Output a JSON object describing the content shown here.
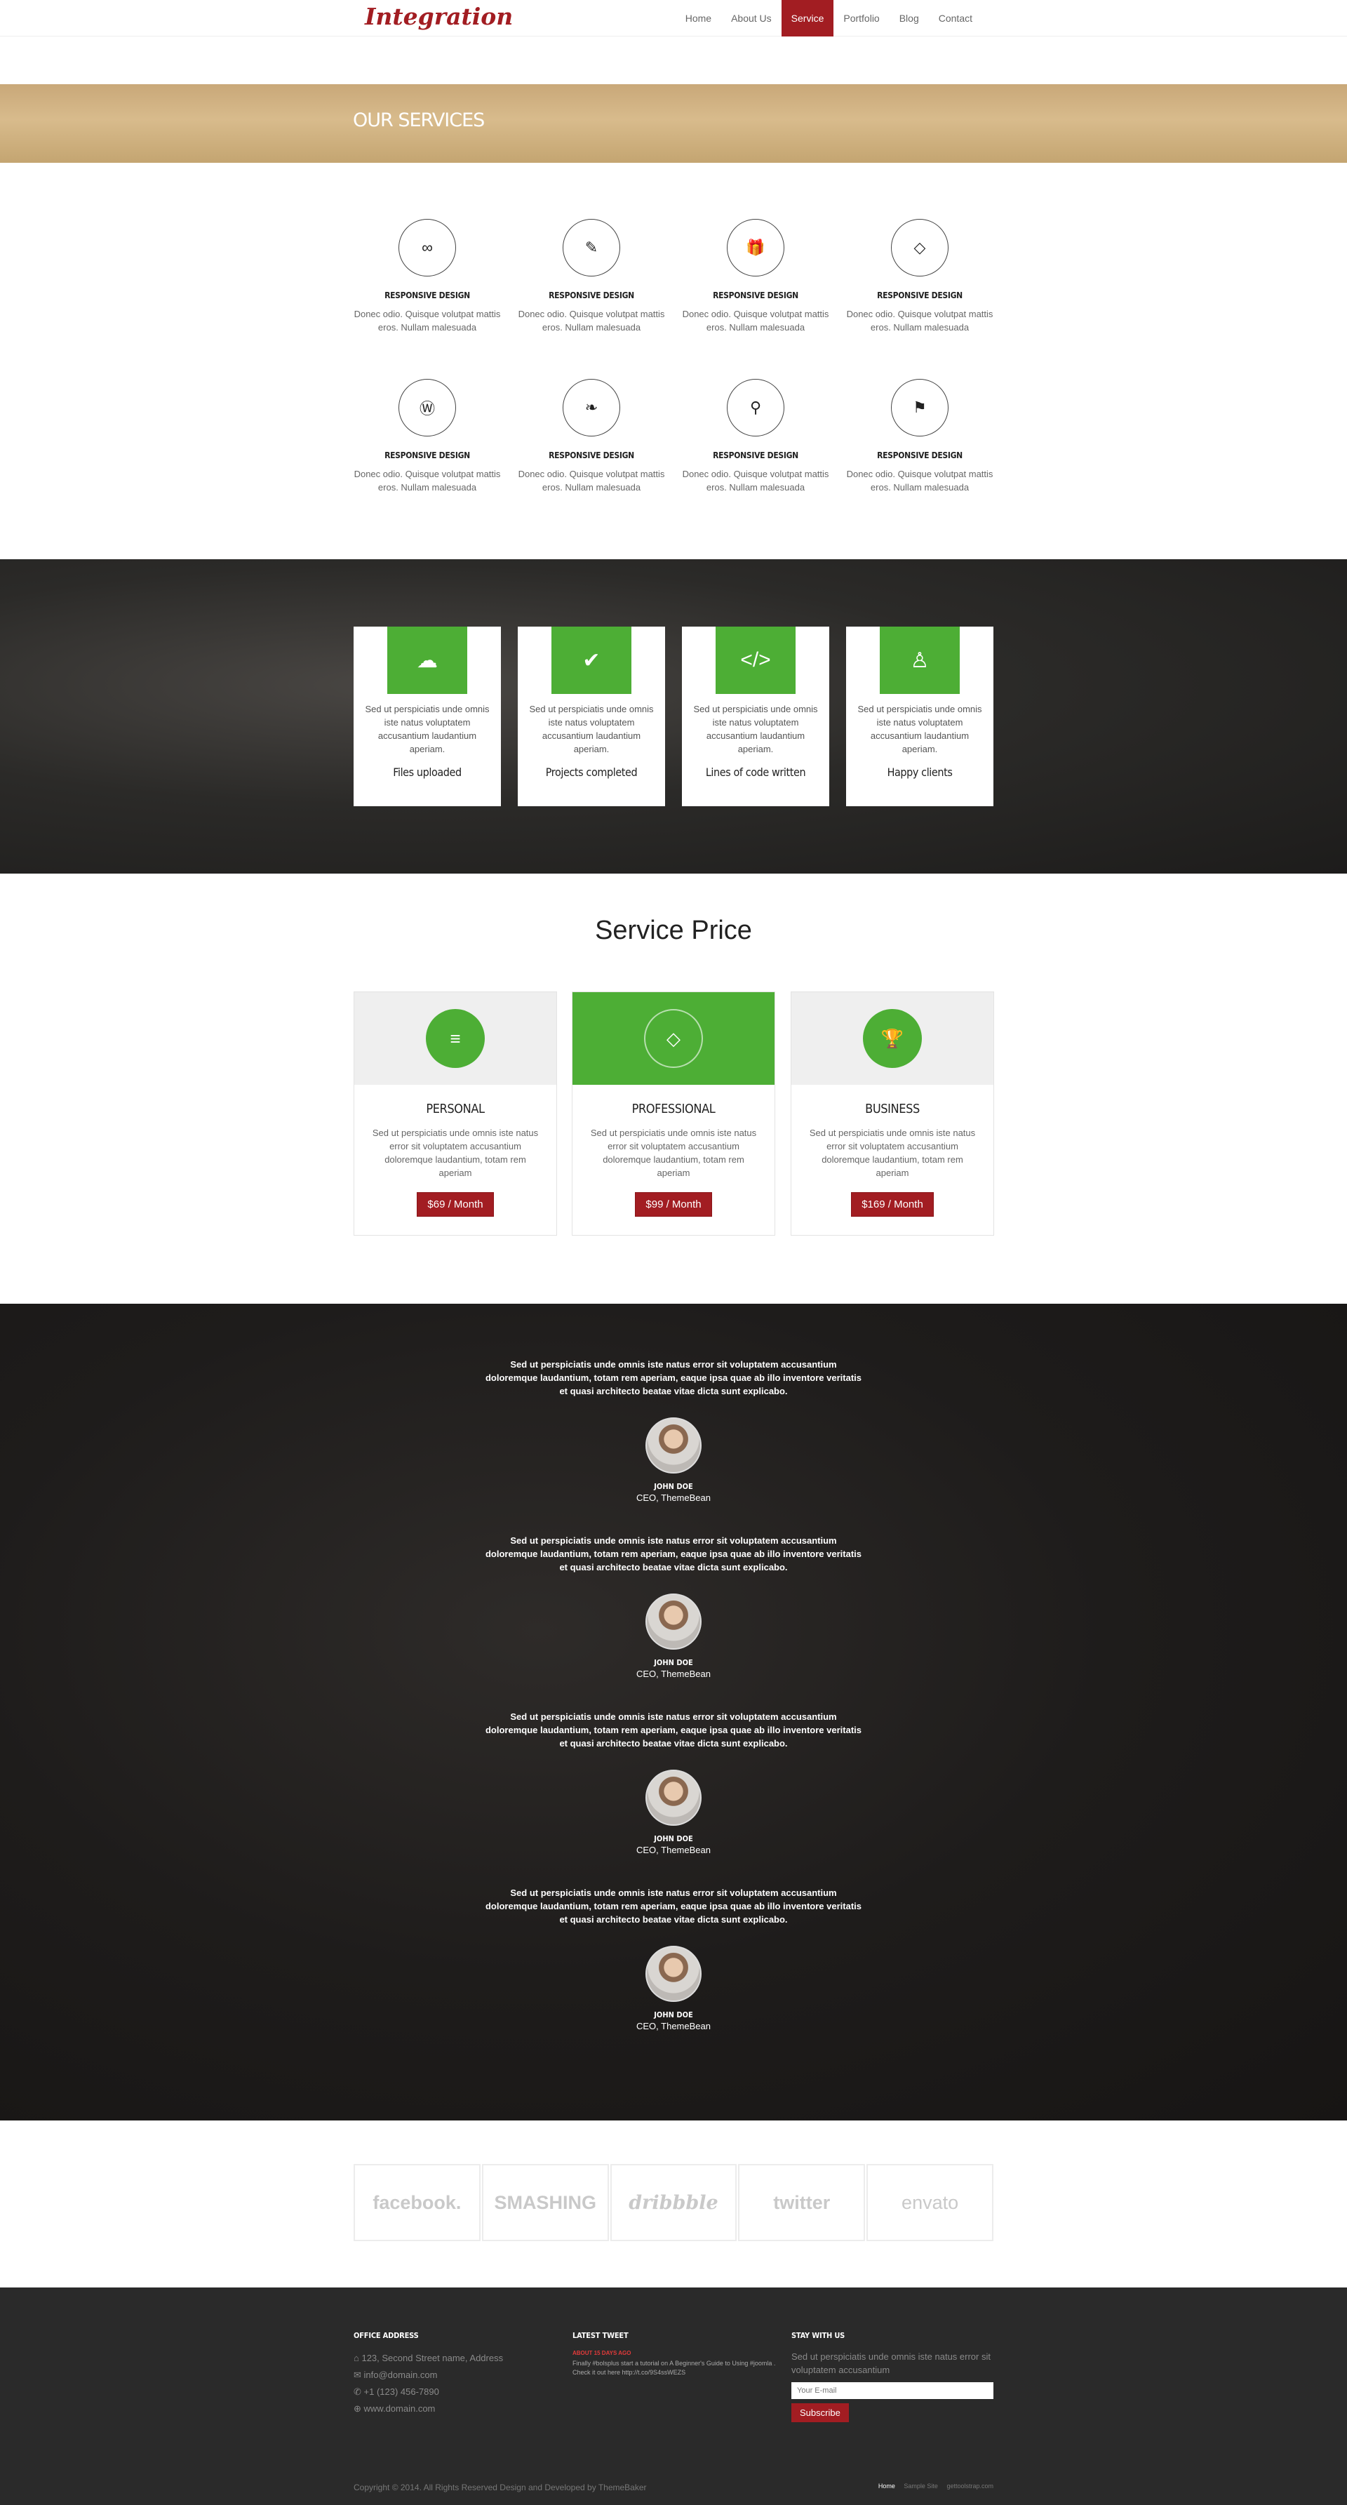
{
  "header": {
    "logo": "Integration",
    "nav": [
      "Home",
      "About Us",
      "Service",
      "Portfolio",
      "Blog",
      "Contact"
    ],
    "active": "Service"
  },
  "banner": {
    "title": "OUR SERVICES"
  },
  "services": {
    "items": [
      {
        "icon": "infinity-icon",
        "glyph": "∞",
        "title": "RESPONSIVE DESIGN",
        "text": "Donec odio. Quisque volutpat mattis eros. Nullam malesuada"
      },
      {
        "icon": "magic-wand-icon",
        "glyph": "✎",
        "title": "RESPONSIVE DESIGN",
        "text": "Donec odio. Quisque volutpat mattis eros. Nullam malesuada"
      },
      {
        "icon": "gift-icon",
        "glyph": "🎁",
        "title": "RESPONSIVE DESIGN",
        "text": "Donec odio. Quisque volutpat mattis eros. Nullam malesuada"
      },
      {
        "icon": "diamond-icon",
        "glyph": "◇",
        "title": "RESPONSIVE DESIGN",
        "text": "Donec odio. Quisque volutpat mattis eros. Nullam malesuada"
      },
      {
        "icon": "wordpress-icon",
        "glyph": "Ⓦ",
        "title": "RESPONSIVE DESIGN",
        "text": "Donec odio. Quisque volutpat mattis eros. Nullam malesuada"
      },
      {
        "icon": "feather-icon",
        "glyph": "❧",
        "title": "RESPONSIVE DESIGN",
        "text": "Donec odio. Quisque volutpat mattis eros. Nullam malesuada"
      },
      {
        "icon": "bicycle-icon",
        "glyph": "⚲",
        "title": "RESPONSIVE DESIGN",
        "text": "Donec odio. Quisque volutpat mattis eros. Nullam malesuada"
      },
      {
        "icon": "flag-icon",
        "glyph": "⚑",
        "title": "RESPONSIVE DESIGN",
        "text": "Donec odio. Quisque volutpat mattis eros. Nullam malesuada"
      }
    ]
  },
  "counters": {
    "items": [
      {
        "icon": "cloud-upload-icon",
        "glyph": "☁",
        "text": "Sed ut perspiciatis unde omnis iste natus voluptatem accusantium laudantium aperiam.",
        "label": "Files uploaded"
      },
      {
        "icon": "check-icon",
        "glyph": "✔",
        "text": "Sed ut perspiciatis unde omnis iste natus voluptatem accusantium laudantium aperiam.",
        "label": "Projects completed"
      },
      {
        "icon": "code-icon",
        "glyph": "</>",
        "text": "Sed ut perspiciatis unde omnis iste natus voluptatem accusantium laudantium aperiam.",
        "label": "Lines of code written"
      },
      {
        "icon": "user-icon",
        "glyph": "♙",
        "text": "Sed ut perspiciatis unde omnis iste natus voluptatem accusantium laudantium aperiam.",
        "label": "Happy clients"
      }
    ]
  },
  "pricing": {
    "title": "Service Price",
    "plans": [
      {
        "icon": "menu-icon",
        "glyph": "≡",
        "name": "PERSONAL",
        "text": "Sed ut perspiciatis unde omnis iste natus error sit voluptatem accusantium doloremque laudantium, totam rem aperiam",
        "price": "$69 / Month"
      },
      {
        "icon": "diamond-icon",
        "glyph": "◇",
        "name": "PROFESSIONAL",
        "text": "Sed ut perspiciatis unde omnis iste natus error sit voluptatem accusantium doloremque laudantium, totam rem aperiam",
        "price": "$99 / Month"
      },
      {
        "icon": "trophy-icon",
        "glyph": "🏆",
        "name": "BUSINESS",
        "text": "Sed ut perspiciatis unde omnis iste natus error sit voluptatem accusantium doloremque laudantium, totam rem aperiam",
        "price": "$169 / Month"
      }
    ]
  },
  "testimonials": [
    {
      "quote": "Sed ut perspiciatis unde omnis iste natus error sit voluptatem accusantium doloremque laudantium, totam rem aperiam, eaque ipsa quae ab illo inventore veritatis et quasi architecto beatae vitae dicta sunt explicabo.",
      "name": "JOHN DOE",
      "role": "CEO, ThemeBean"
    },
    {
      "quote": "Sed ut perspiciatis unde omnis iste natus error sit voluptatem accusantium doloremque laudantium, totam rem aperiam, eaque ipsa quae ab illo inventore veritatis et quasi architecto beatae vitae dicta sunt explicabo.",
      "name": "JOHN DOE",
      "role": "CEO, ThemeBean"
    },
    {
      "quote": "Sed ut perspiciatis unde omnis iste natus error sit voluptatem accusantium doloremque laudantium, totam rem aperiam, eaque ipsa quae ab illo inventore veritatis et quasi architecto beatae vitae dicta sunt explicabo.",
      "name": "JOHN DOE",
      "role": "CEO, ThemeBean"
    },
    {
      "quote": "Sed ut perspiciatis unde omnis iste natus error sit voluptatem accusantium doloremque laudantium, totam rem aperiam, eaque ipsa quae ab illo inventore veritatis et quasi architecto beatae vitae dicta sunt explicabo.",
      "name": "JOHN DOE",
      "role": "CEO, ThemeBean"
    }
  ],
  "partners": [
    "facebook.",
    "SMASHING",
    "dribbble",
    "twitter",
    "envato"
  ],
  "footer": {
    "office_title": "OFFICE ADDRESS",
    "address": "123, Second Street name, Address",
    "email": "info@domain.com",
    "phone": "+1 (123) 456-7890",
    "site": "www.domain.com",
    "tweet_title": "LATEST TWEET",
    "tweet_head": "ABOUT 15 DAYS AGO",
    "tweet_text": "Finally #bolsplus start a tutorial on A Beginner's Guide to Using #joomla . Check it out here http://t.co/9S4ssWEZS",
    "stay_title": "STAY WITH US",
    "stay_text": "Sed ut perspiciatis unde omnis iste natus error sit voluptatem accusantium",
    "email_placeholder": "Your E-mail",
    "subscribe": "Subscribe",
    "copyright": "Copyright © 2014. All Rights Reserved Design and Developed by ThemeBaker",
    "links": [
      "Home",
      "Sample Site",
      "gettoolstrap.com"
    ]
  }
}
